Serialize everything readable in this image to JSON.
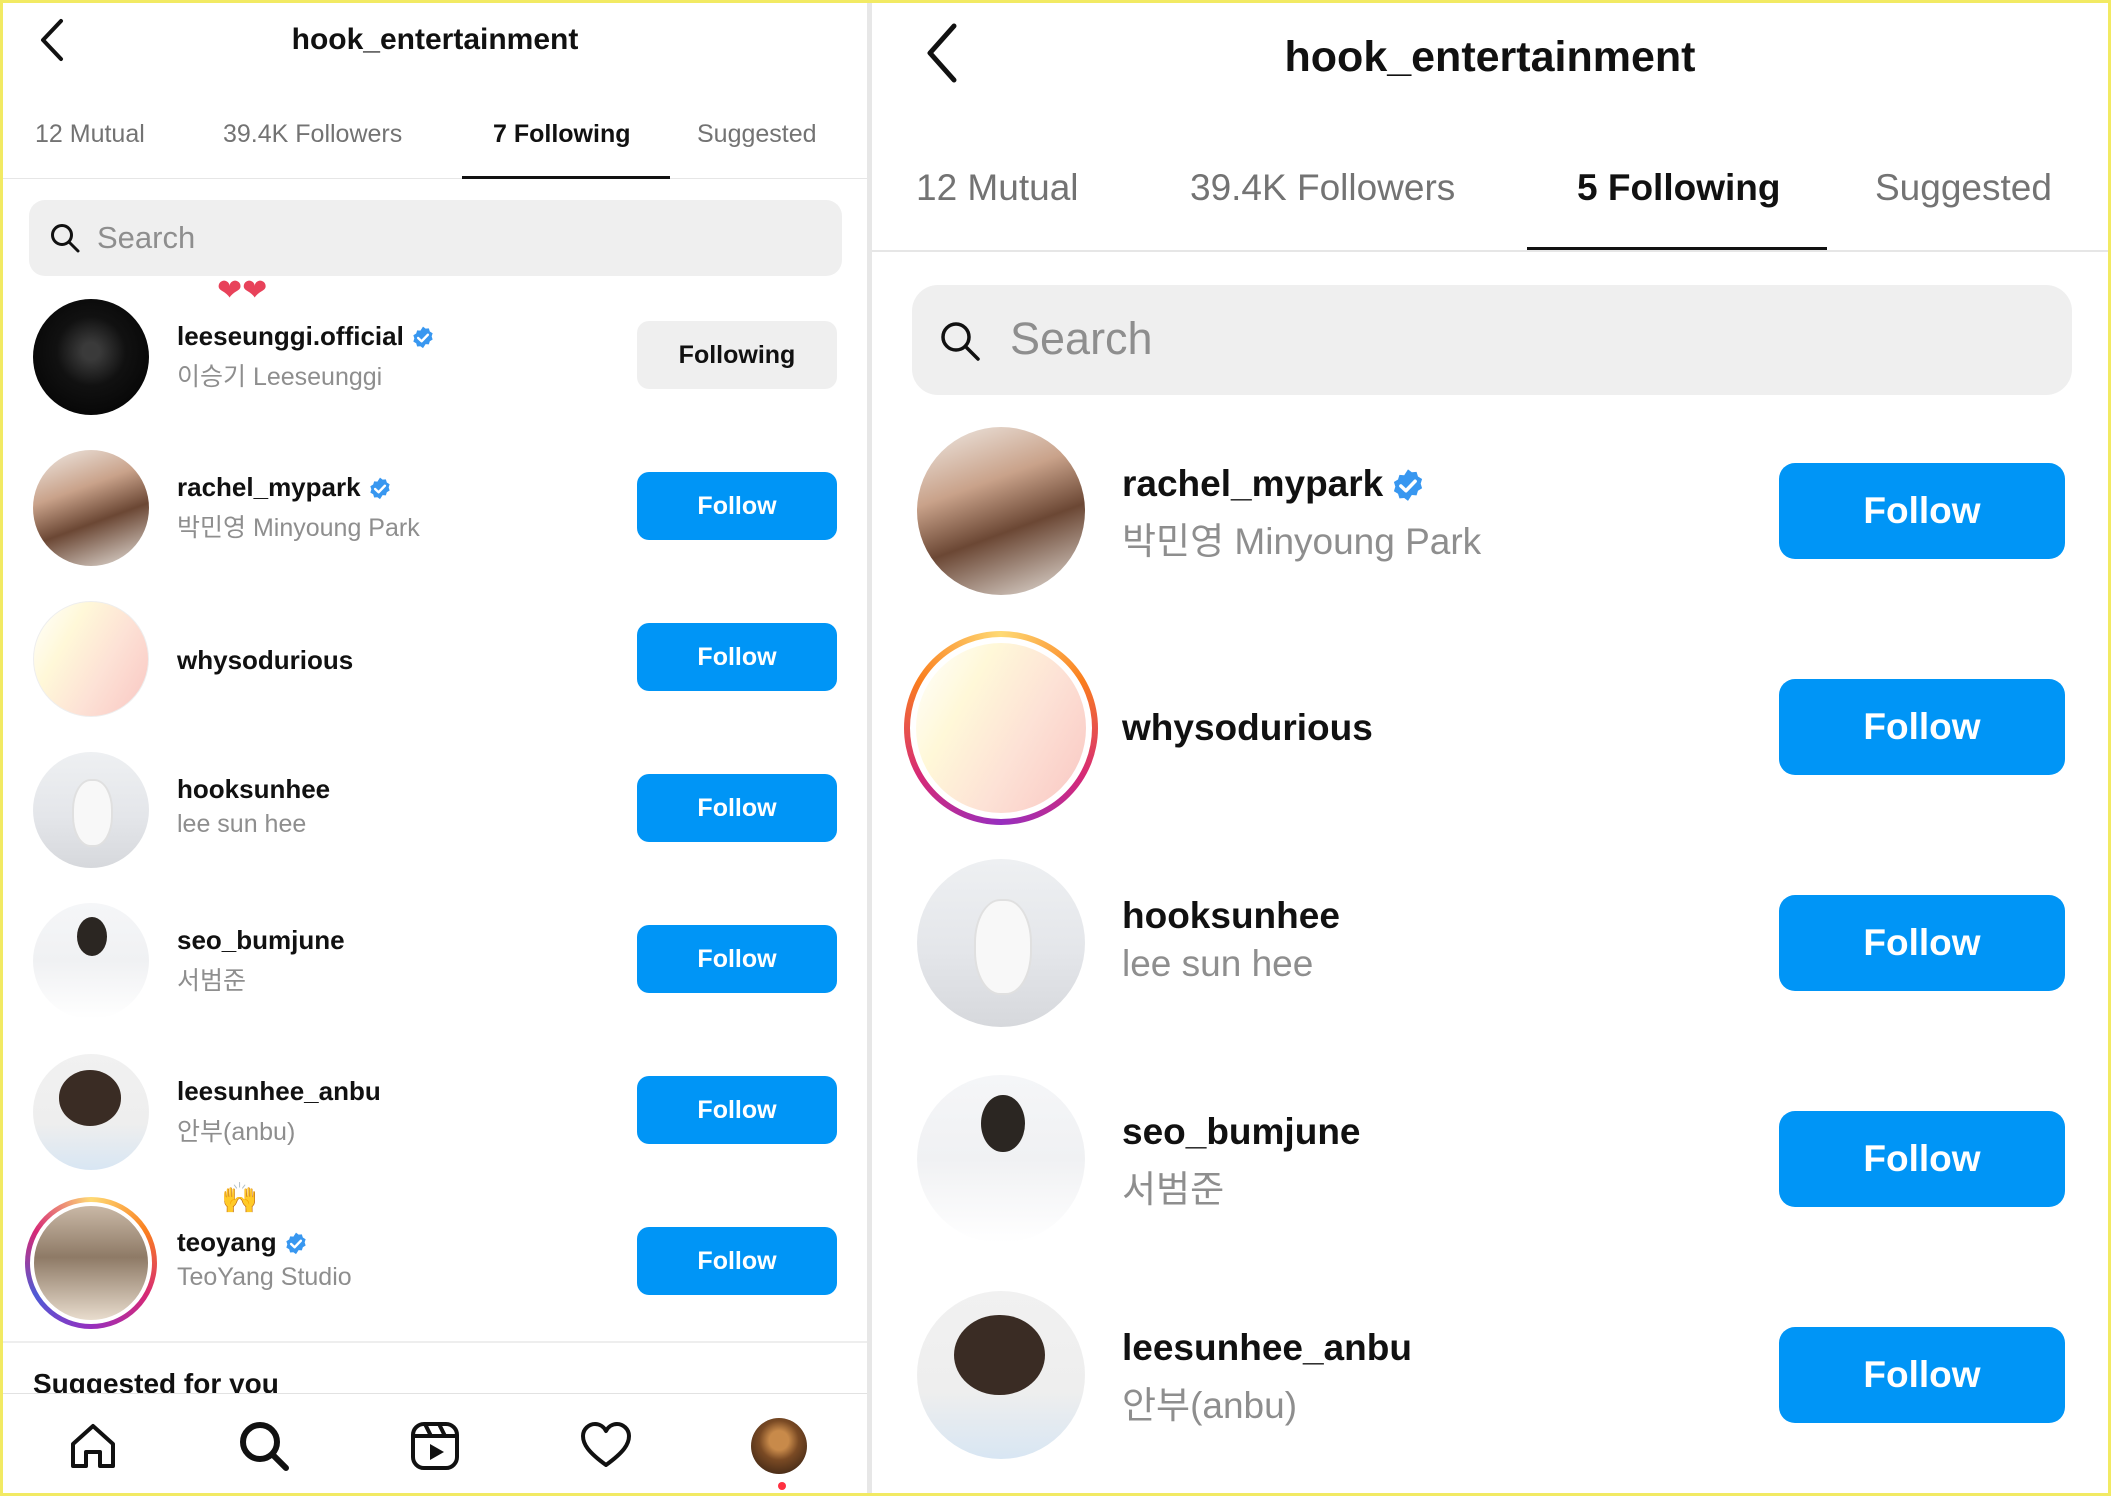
{
  "left": {
    "title": "hook_entertainment",
    "tabs": [
      "12 Mutual",
      "39.4K Followers",
      "7 Following",
      "Suggested"
    ],
    "active_tab": "7 Following",
    "search_placeholder": "Search",
    "rows": [
      {
        "username": "leeseunggi.official",
        "name": "이승기 Leeseunggi",
        "verified": true,
        "button": "Following"
      },
      {
        "username": "rachel_mypark",
        "name": "박민영 Minyoung Park",
        "verified": true,
        "button": "Follow"
      },
      {
        "username": "whysodurious",
        "name": "",
        "verified": false,
        "button": "Follow"
      },
      {
        "username": "hooksunhee",
        "name": "lee sun hee",
        "verified": false,
        "button": "Follow"
      },
      {
        "username": "seo_bumjune",
        "name": "서범준",
        "verified": false,
        "button": "Follow"
      },
      {
        "username": "leesunhee_anbu",
        "name": "안부(anbu)",
        "verified": false,
        "button": "Follow"
      },
      {
        "username": "teoyang",
        "name": "TeoYang Studio",
        "verified": true,
        "button": "Follow"
      }
    ],
    "emoji_hearts": "❤❤",
    "emoji_hands": "🙌",
    "suggested_heading": "Suggested for you"
  },
  "right": {
    "title": "hook_entertainment",
    "tabs": [
      "12 Mutual",
      "39.4K Followers",
      "5 Following",
      "Suggested"
    ],
    "active_tab": "5 Following",
    "search_placeholder": "Search",
    "rows": [
      {
        "username": "rachel_mypark",
        "name": "박민영 Minyoung Park",
        "verified": true,
        "button": "Follow"
      },
      {
        "username": "whysodurious",
        "name": "",
        "verified": false,
        "button": "Follow"
      },
      {
        "username": "hooksunhee",
        "name": "lee sun hee",
        "verified": false,
        "button": "Follow"
      },
      {
        "username": "seo_bumjune",
        "name": "서범준",
        "verified": false,
        "button": "Follow"
      },
      {
        "username": "leesunhee_anbu",
        "name": "안부(anbu)",
        "verified": false,
        "button": "Follow"
      }
    ]
  },
  "icons": {
    "back": "chevron-left-icon",
    "search": "search-icon",
    "verified": "verified-badge-icon",
    "nav": [
      "home-icon",
      "search-icon",
      "reels-icon",
      "heart-icon",
      "profile-avatar"
    ]
  },
  "colors": {
    "follow_button": "#0095f6",
    "following_button": "#efefef",
    "verified": "#3897f0",
    "notification_dot": "#ff3040",
    "frame_border": "#f2ea63"
  }
}
